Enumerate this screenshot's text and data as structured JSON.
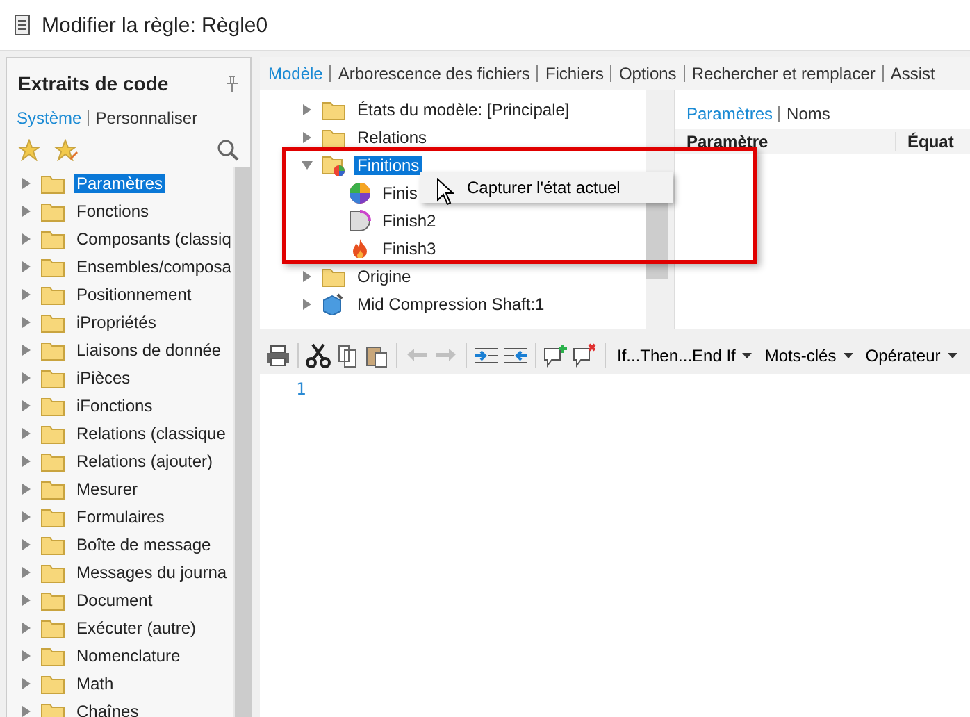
{
  "window": {
    "title": "Modifier la règle: Règle0"
  },
  "snippets": {
    "title": "Extraits de code",
    "tabs": [
      {
        "label": "Système",
        "selected": true
      },
      {
        "label": "Personnaliser",
        "selected": false
      }
    ],
    "items": [
      {
        "label": "Paramètres",
        "selected": true
      },
      {
        "label": "Fonctions",
        "selected": false
      },
      {
        "label": "Composants (classiq",
        "selected": false
      },
      {
        "label": "Ensembles/composa",
        "selected": false
      },
      {
        "label": "Positionnement",
        "selected": false
      },
      {
        "label": "iPropriétés",
        "selected": false
      },
      {
        "label": "Liaisons de donnée",
        "selected": false
      },
      {
        "label": "iPièces",
        "selected": false
      },
      {
        "label": "iFonctions",
        "selected": false
      },
      {
        "label": "Relations (classique",
        "selected": false
      },
      {
        "label": "Relations (ajouter)",
        "selected": false
      },
      {
        "label": "Mesurer",
        "selected": false
      },
      {
        "label": "Formulaires",
        "selected": false
      },
      {
        "label": "Boîte de message",
        "selected": false
      },
      {
        "label": "Messages du journa",
        "selected": false
      },
      {
        "label": "Document",
        "selected": false
      },
      {
        "label": "Exécuter (autre)",
        "selected": false
      },
      {
        "label": "Nomenclature",
        "selected": false
      },
      {
        "label": "Math",
        "selected": false
      },
      {
        "label": "Chaînes",
        "selected": false
      }
    ]
  },
  "tabs": [
    {
      "label": "Modèle",
      "selected": true
    },
    {
      "label": "Arborescence des fichiers",
      "selected": false
    },
    {
      "label": "Fichiers",
      "selected": false
    },
    {
      "label": "Options",
      "selected": false
    },
    {
      "label": "Rechercher et remplacer",
      "selected": false
    },
    {
      "label": "Assist",
      "selected": false
    }
  ],
  "model_tree": [
    {
      "label": "États du modèle: [Principale]",
      "kind": "folder",
      "expanded": false,
      "selected": false
    },
    {
      "label": "Relations",
      "kind": "folder",
      "expanded": false,
      "selected": false
    },
    {
      "label": "Finitions",
      "kind": "finish-folder",
      "expanded": true,
      "selected": true,
      "children": [
        {
          "label": "Finis",
          "kind": "sphere"
        },
        {
          "label": "Finish2",
          "kind": "appearance"
        },
        {
          "label": "Finish3",
          "kind": "fire"
        }
      ]
    },
    {
      "label": "Origine",
      "kind": "folder",
      "expanded": false,
      "selected": false
    },
    {
      "label": "Mid Compression Shaft:1",
      "kind": "part",
      "expanded": false,
      "selected": false
    }
  ],
  "context_menu": {
    "items": [
      "Capturer l'état actuel"
    ]
  },
  "parameters": {
    "tabs": [
      {
        "label": "Paramètres",
        "selected": true
      },
      {
        "label": "Noms",
        "selected": false
      }
    ],
    "columns": [
      "Paramètre",
      "Équat"
    ]
  },
  "toolbar": {
    "dropdowns": [
      "If...Then...End If",
      "Mots-clés",
      "Opérateur"
    ]
  },
  "editor": {
    "line_numbers": [
      "1"
    ]
  }
}
